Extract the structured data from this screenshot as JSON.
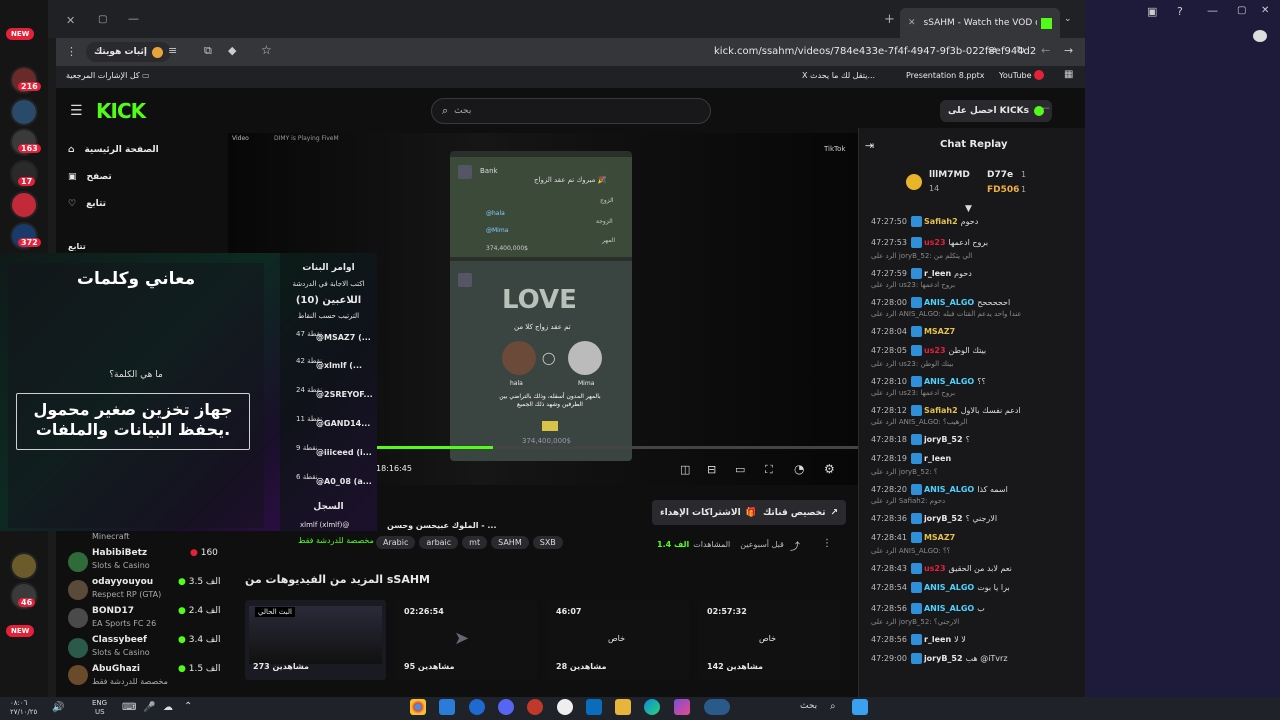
{
  "browser": {
    "tab_title": "sSAHM - Watch the VOD on Ki",
    "url": "kick.com/ssahm/videos/784e433e-7f4f-4947-9f3b-022f8ef944d2",
    "sync_label": "إثبات هويتك",
    "bookmarks_folder": "كل الإشارات المرجعية",
    "bookmarks": [
      "X يتقل لك ما يحدث...",
      "Presentation 8.pptx",
      "YouTube"
    ]
  },
  "os": {
    "new1": "NEW",
    "badges": [
      "216",
      "163",
      "17",
      "372",
      "46"
    ],
    "new2": "NEW"
  },
  "kick": {
    "logo": "KICK",
    "search_placeholder": "بحث",
    "get_kicks": "احصل على KICKs",
    "nav": [
      "الصفحة الرئيسية",
      "تصفح",
      "تتابع"
    ],
    "following_label": "تتابع"
  },
  "sidebar_channels": [
    {
      "name": "Minecraft",
      "sub": "",
      "viewers": ""
    },
    {
      "name": "HabibiBetz",
      "sub": "Slots & Casino",
      "viewers": "160"
    },
    {
      "name": "odayyouyou",
      "sub": "Respect RP (GTA)",
      "viewers": "3.5 الف"
    },
    {
      "name": "BOND17",
      "sub": "EA Sports FC 26",
      "viewers": "2.4 الف"
    },
    {
      "name": "Classybeef",
      "sub": "Slots & Casino",
      "viewers": "3.4 الف"
    },
    {
      "name": "AbuGhazi",
      "sub": "مخصصة للدردشة فقط",
      "viewers": "1.5 الف"
    }
  ],
  "overlay": {
    "title": "معاني وكلمات",
    "question": "ما هي الكلمة؟",
    "clue": "جهاز تخزين صغير محمول يحفظ البيانات والملفات.",
    "commands_title": "اوامر البنات",
    "commands_sub": "اكتب الاجابة في الدردشة",
    "players_title": "اللاعبين (10)",
    "players_sub": "الترتيب حسب النقاط",
    "players": [
      {
        "pts": "47 نقطة",
        "name": "@MSAZ7 (..."
      },
      {
        "pts": "42 نقطة",
        "name": "@xlmlf (..."
      },
      {
        "pts": "24 نقطة",
        "name": "@2SREYOF..."
      },
      {
        "pts": "11 نقطة",
        "name": "@GAND14..."
      },
      {
        "pts": "9 نقطة",
        "name": "@iiiceed (i..."
      },
      {
        "pts": "6 نقطة",
        "name": "@A0_08 (a..."
      }
    ],
    "log_title": "السجل",
    "log_line": "xlmlf (xlmlf)@"
  },
  "video": {
    "top_left": "Video",
    "top_center": "DIMY is Playing FiveM",
    "top_right": "TikTok",
    "time": "18:16:45",
    "love": "LOVE",
    "bank_title": "Bank",
    "msg1": "مبروك تم عقد الزواج 🎉",
    "row_labels": [
      "الزوج",
      "الزوجة",
      "المهر"
    ],
    "row_vals": [
      "@hala",
      "@Mima",
      "374,400,000$"
    ],
    "couple_a": "hala",
    "couple_b": "Mima",
    "vow": "تم عقد زواج كلا من",
    "vow2": "بالمهر المدون أسفله، وذلك بالتراضي بين الطرفين وشهد ذلك الجميع",
    "amount": "374,400,000$"
  },
  "below": {
    "streamer_title": "الملوك عبيحسن وحسن - ...",
    "category": "مخصصة للدردشة فقط",
    "tags": [
      "Arabic",
      "arbaic",
      "mt",
      "SAHM",
      "SXB"
    ],
    "views": "1.4 الف",
    "views_label": "المشاهدات",
    "ago": "قبل أسبوعين",
    "subs_btn": "الاشتراكات الإهداء",
    "custom_btn": "تخصيص قناتك",
    "more_title": "المزيد من الفيديوهات من sSAHM"
  },
  "videos": [
    {
      "dur": "",
      "views": "273 مشاهدين",
      "label": "البث الحالي"
    },
    {
      "dur": "02:26:54",
      "views": "95 مشاهدين",
      "label": ""
    },
    {
      "dur": "46:07",
      "views": "28 مشاهدين",
      "label": "خاص"
    },
    {
      "dur": "02:57:32",
      "views": "142 مشاهدين",
      "label": "خاص"
    }
  ],
  "chat": {
    "title": "Chat Replay",
    "top": [
      {
        "name": "lllM7MD",
        "n": "14"
      },
      {
        "name": "D77e",
        "n": "1"
      },
      {
        "name": "FD506",
        "n": "1"
      }
    ],
    "lines": [
      {
        "t": "47:27:50",
        "u": "Safiah2",
        "c": "#e5c14a",
        "m": "دحوم",
        "r": ""
      },
      {
        "t": "47:27:53",
        "u": "us23",
        "c": "#e5213a",
        "m": "بروح ادعمها",
        "r": ""
      },
      {
        "t": "47:27:59",
        "u": "r_leen",
        "c": "#e8e8e8",
        "m": "دحوم",
        "r": "الرد على joryB_52: الي يتكلم من"
      },
      {
        "t": "47:28:00",
        "u": "ANIS_ALGO",
        "c": "#4fd2ff",
        "m": "احححححح",
        "r": "الرد على us23: بروح ادعمها"
      },
      {
        "t": "47:28:04",
        "u": "MSAZ7",
        "c": "#e5c14a",
        "m": "",
        "r": "الرد على ANIS_ALGO: عندا واحد يدعم القتات فبله"
      },
      {
        "t": "47:28:05",
        "u": "us23",
        "c": "#e5213a",
        "m": "بيتك الوطن",
        "r": ""
      },
      {
        "t": "47:28:10",
        "u": "ANIS_ALGO",
        "c": "#4fd2ff",
        "m": "؟؟",
        "r": "الرد على us23: بيتك الوطن"
      },
      {
        "t": "47:28:12",
        "u": "Safiah2",
        "c": "#e5c14a",
        "m": "ادعم نفسك بالاول",
        "r": "الرد على us23: بروح ادعمها"
      },
      {
        "t": "47:28:18",
        "u": "joryB_52",
        "c": "#e8e8e8",
        "m": "؟",
        "r": "الرد على ANIS_ALGO: الرهيب؟"
      },
      {
        "t": "47:28:19",
        "u": "r_leen",
        "c": "#e8e8e8",
        "m": "",
        "r": ""
      },
      {
        "t": "47:28:20",
        "u": "ANIS_ALGO",
        "c": "#4fd2ff",
        "m": "اسمه كذا",
        "r": "الرد على joryB_52: ؟"
      },
      {
        "t": "47:28:36",
        "u": "joryB_52",
        "c": "#e8e8e8",
        "m": "الارجني ؟",
        "r": "الرد على Safiah2: دحوم"
      },
      {
        "t": "47:28:41",
        "u": "MSAZ7",
        "c": "#e5c14a",
        "m": "",
        "r": ""
      },
      {
        "t": "47:28:43",
        "u": "us23",
        "c": "#e5213a",
        "m": "نعم لابد من الحقيق",
        "r": "الرد على ANIS_ALGO: ؟؟"
      },
      {
        "t": "47:28:54",
        "u": "ANIS_ALGO",
        "c": "#4fd2ff",
        "m": "برا يا بوت",
        "r": ""
      },
      {
        "t": "47:28:56",
        "u": "ANIS_ALGO",
        "c": "#4fd2ff",
        "m": "ب",
        "r": ""
      },
      {
        "t": "47:28:56",
        "u": "r_leen",
        "c": "#e8e8e8",
        "m": "لا لا",
        "r": "الرد على joryB_52: الارجني؟"
      },
      {
        "t": "47:29:00",
        "u": "joryB_52",
        "c": "#e8e8e8",
        "m": "هب @iTvrz",
        "r": ""
      }
    ]
  },
  "taskbar": {
    "time": "٠٨:٠٦",
    "date": "٢٧/١٠/٢٥",
    "lang": "ENG",
    "lang2": "US",
    "search": "بحث"
  }
}
